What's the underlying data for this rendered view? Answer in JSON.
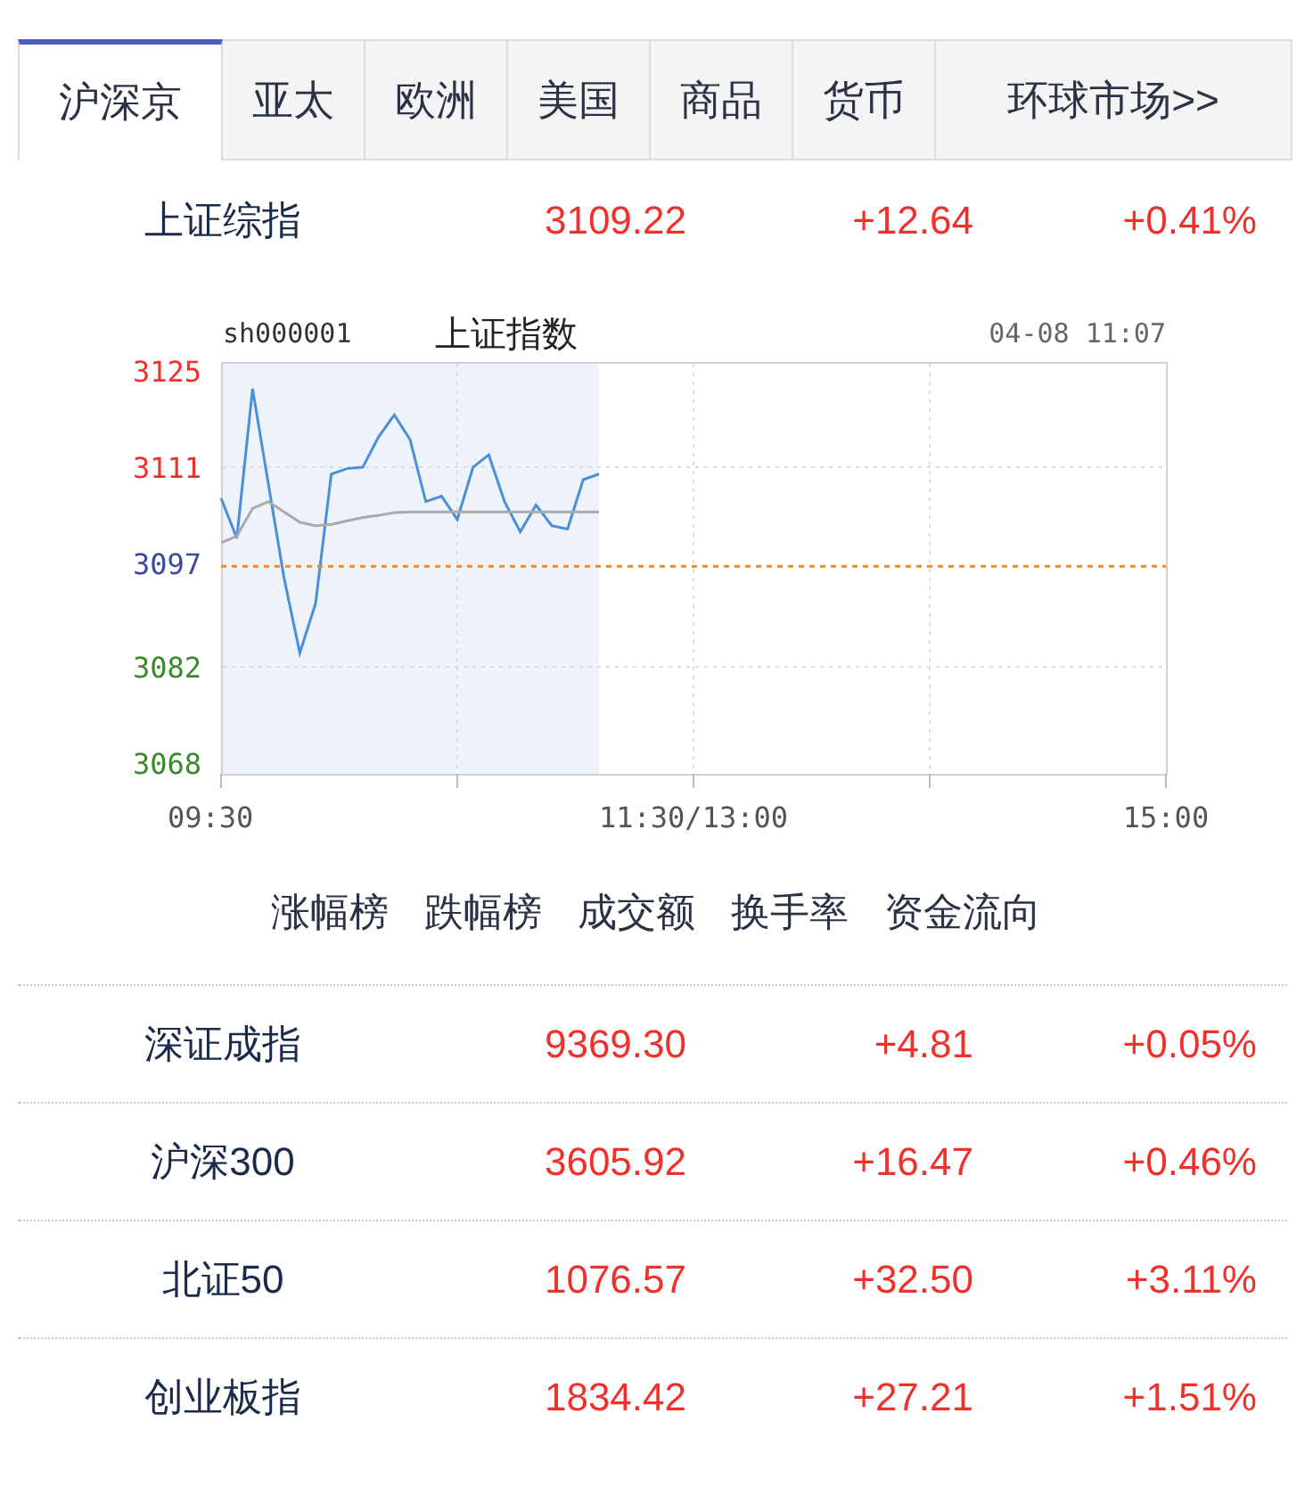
{
  "tabs": [
    {
      "label": "沪深京",
      "selected": true
    },
    {
      "label": "亚太",
      "selected": false
    },
    {
      "label": "欧洲",
      "selected": false
    },
    {
      "label": "美国",
      "selected": false
    },
    {
      "label": "商品",
      "selected": false
    },
    {
      "label": "货币",
      "selected": false
    },
    {
      "label": "环球市场>>",
      "selected": false
    }
  ],
  "featured_index": {
    "name": "上证综指",
    "value": "3109.22",
    "change": "+12.64",
    "percent": "+0.41%"
  },
  "chart": {
    "code": "sh000001",
    "name": "上证指数",
    "datetime": "04-08 11:07",
    "chart_data": {
      "type": "line",
      "categories": [
        "09:30",
        null,
        null,
        null,
        null,
        null,
        null,
        null,
        null,
        null,
        null,
        null,
        null,
        null,
        null,
        null,
        null,
        null,
        null,
        null,
        null,
        null,
        null,
        null,
        null,
        null,
        null,
        null,
        null,
        null,
        "11:30/13:00",
        null,
        null,
        null,
        null,
        null,
        null,
        null,
        null,
        null,
        null,
        null,
        null,
        null,
        null,
        null,
        null,
        null,
        null,
        null,
        null,
        null,
        null,
        null,
        null,
        null,
        null,
        null,
        null,
        null,
        "15:00"
      ],
      "series": [
        {
          "color": "#4a90d9",
          "values": [
            3106.5,
            3100.7,
            3122.4,
            3108.6,
            3094.9,
            3084,
            3091.2,
            3110,
            3110.8,
            3111,
            3115.4,
            3118.6,
            3115,
            3106,
            3106.8,
            3103.4,
            3111,
            3112.8,
            3106,
            3101.6,
            3105.5,
            3102.5,
            3102,
            3109.2,
            3110,
            null,
            null,
            null,
            null,
            null,
            null,
            null,
            null,
            null,
            null,
            null,
            null,
            null,
            null,
            null,
            null,
            null,
            null,
            null,
            null,
            null,
            null,
            null,
            null,
            null,
            null,
            null,
            null,
            null,
            null,
            null,
            null,
            null,
            null,
            null,
            null
          ]
        },
        {
          "color": "#aaaaaa",
          "values": [
            3100,
            3101,
            3105,
            3106,
            3104.5,
            3103,
            3102.5,
            3102.7,
            3103.2,
            3103.7,
            3104,
            3104.4,
            3104.5,
            3104.5,
            3104.5,
            3104.5,
            3104.5,
            3104.5,
            3104.5,
            3104.5,
            3104.5,
            3104.5,
            3104.5,
            3104.5,
            3104.5,
            null,
            null,
            null,
            null,
            null,
            null,
            null,
            null,
            null,
            null,
            null,
            null,
            null,
            null,
            null,
            null,
            null,
            null,
            null,
            null,
            null,
            null,
            null,
            null,
            null,
            null,
            null,
            null,
            null,
            null,
            null,
            null,
            null,
            null,
            null,
            null
          ]
        },
        {
          "color": "#f08a24",
          "line_style": "dashed",
          "values": [
            3096.6,
            3096.6,
            3096.6,
            3096.6,
            3096.6,
            3096.6,
            3096.6,
            3096.6,
            3096.6,
            3096.6,
            3096.6,
            3096.6,
            3096.6,
            3096.6,
            3096.6,
            3096.6,
            3096.6,
            3096.6,
            3096.6,
            3096.6,
            3096.6,
            3096.6,
            3096.6,
            3096.6,
            3096.6,
            3096.6,
            3096.6,
            3096.6,
            3096.6,
            3096.6,
            3096.6,
            3096.6,
            3096.6,
            3096.6,
            3096.6,
            3096.6,
            3096.6,
            3096.6,
            3096.6,
            3096.6,
            3096.6,
            3096.6,
            3096.6,
            3096.6,
            3096.6,
            3096.6,
            3096.6,
            3096.6,
            3096.6,
            3096.6,
            3096.6,
            3096.6,
            3096.6,
            3096.6,
            3096.6,
            3096.6,
            3096.6,
            3096.6,
            3096.6,
            3096.6,
            3096.6
          ]
        }
      ],
      "ylim": [
        3068,
        3125
      ],
      "grid": true,
      "yticks": [
        {
          "value": 3125,
          "label": "3125"
        },
        {
          "value": 3111,
          "label": "3111"
        },
        {
          "value": 3097,
          "label": "3097"
        },
        {
          "value": 3082,
          "label": "3082"
        },
        {
          "value": 3068,
          "label": "3068"
        }
      ]
    }
  },
  "links": [
    "涨幅榜",
    "跌幅榜",
    "成交额",
    "换手率",
    "资金流向"
  ],
  "indices": [
    {
      "name": "深证成指",
      "value": "9369.30",
      "change": "+4.81",
      "percent": "+0.05%"
    },
    {
      "name": "沪深300",
      "value": "3605.92",
      "change": "+16.47",
      "percent": "+0.46%"
    },
    {
      "name": "北证50",
      "value": "1076.57",
      "change": "+32.50",
      "percent": "+3.11%"
    },
    {
      "name": "创业板指",
      "value": "1834.42",
      "change": "+27.21",
      "percent": "+1.51%"
    }
  ]
}
